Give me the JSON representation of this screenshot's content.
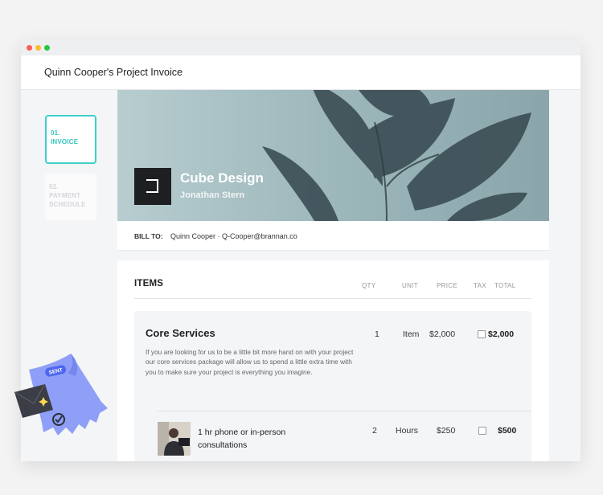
{
  "window": {
    "controls": [
      "close",
      "minimize",
      "maximize"
    ]
  },
  "header": {
    "title": "Quinn Cooper's Project Invoice"
  },
  "steps": [
    {
      "number": "01.",
      "label": "INVOICE",
      "active": true
    },
    {
      "number": "02.",
      "label": "PAYMENT SCHEDULE",
      "active": false
    }
  ],
  "hero": {
    "company": "Cube Design",
    "person": "Jonathan Stern",
    "logo_icon": "cube-logo-icon"
  },
  "bill_to": {
    "label": "BILL TO:",
    "value": "Quinn Cooper · Q-Cooper@brannan.co"
  },
  "items": {
    "title": "ITEMS",
    "columns": {
      "qty": "QTY",
      "unit": "UNIT",
      "price": "PRICE",
      "tax": "TAX",
      "total": "TOTAL"
    },
    "core": {
      "title": "Core Services",
      "description": "If you are looking for us to be a little bit more hand on with your project our core services package will allow us to spend a little extra time with you to make sure your project is everything you imagine.",
      "qty": "1",
      "unit": "Item",
      "price": "$2,000",
      "total": "$2,000",
      "tax_checked": false
    },
    "sub": {
      "title": "1 hr phone or in-person consultations",
      "qty": "2",
      "unit": "Hours",
      "price": "$250",
      "total": "$500",
      "tax_checked": false
    }
  },
  "illustration": {
    "badge": "SENT"
  },
  "colors": {
    "accent": "#3fd0c9",
    "illustration_blue": "#8f9ff7"
  }
}
